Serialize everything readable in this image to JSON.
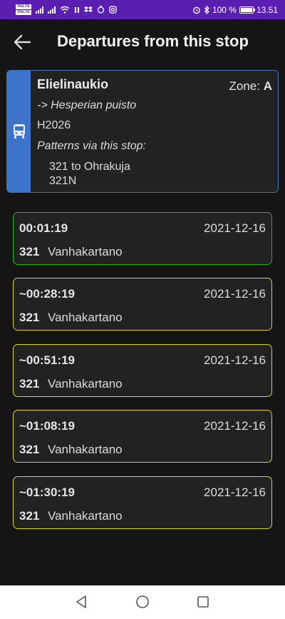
{
  "status_bar": {
    "volte_1": "VoLTE",
    "volte_2": "VoLTE",
    "battery_pct": "100 %",
    "time": "13.51"
  },
  "header": {
    "title": "Departures from this stop",
    "back_icon": "arrow-left-icon"
  },
  "stop": {
    "name": "Elielinaukio",
    "zone_label": "Zone:",
    "zone": "A",
    "direction": "-> Hesperian puisto",
    "code": "H2026",
    "patterns_label": "Patterns via this stop:",
    "patterns": [
      "321 to Ohrakuja",
      "321N"
    ],
    "icon": "bus-icon",
    "accent": "#3d74c9"
  },
  "departures": [
    {
      "time": "00:01:19",
      "date": "2021-12-16",
      "route": "321",
      "destination": "Vanhakartano",
      "border": "#22b422"
    },
    {
      "time": "~00:28:19",
      "date": "2021-12-16",
      "route": "321",
      "destination": "Vanhakartano",
      "border": "#d6d625"
    },
    {
      "time": "~00:51:19",
      "date": "2021-12-16",
      "route": "321",
      "destination": "Vanhakartano",
      "border": "#d6d625"
    },
    {
      "time": "~01:08:19",
      "date": "2021-12-16",
      "route": "321",
      "destination": "Vanhakartano",
      "border": "#d6d625"
    },
    {
      "time": "~01:30:19",
      "date": "2021-12-16",
      "route": "321",
      "destination": "Vanhakartano",
      "border": "#d6d625"
    }
  ],
  "nav": {
    "back_icon": "nav-back-triangle-icon",
    "home_icon": "nav-home-circle-icon",
    "recents_icon": "nav-recents-square-icon"
  }
}
